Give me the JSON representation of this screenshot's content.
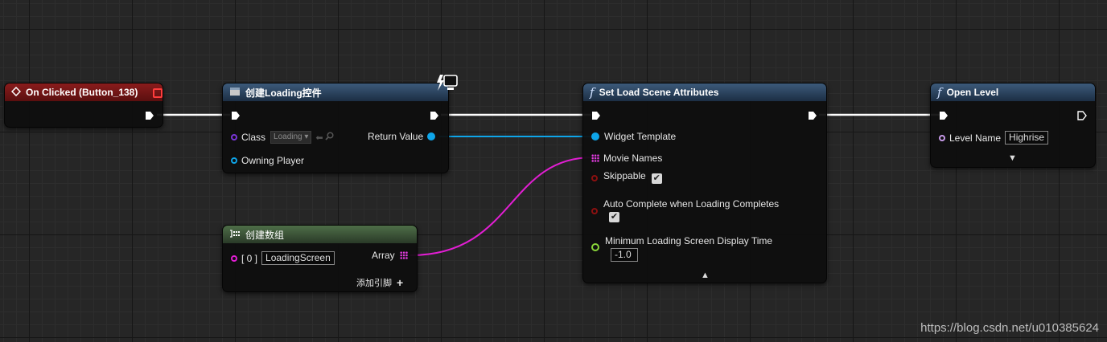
{
  "graph": {
    "event_node": {
      "title": "On Clicked (Button_138)"
    },
    "create_widget_node": {
      "title": "创建Loading控件",
      "class_label": "Class",
      "class_value": "Loading",
      "return_label": "Return Value",
      "owner_label": "Owning Player"
    },
    "make_array_node": {
      "title": "创建数组",
      "index_label": "[ 0 ]",
      "index_value": "LoadingScreen",
      "array_label": "Array",
      "add_pin_label": "添加引脚"
    },
    "set_load_scene_node": {
      "title": "Set Load Scene Attributes",
      "widget_template_label": "Widget Template",
      "movie_names_label": "Movie Names",
      "skippable_label": "Skippable",
      "auto_complete_label": "Auto Complete when Loading Completes",
      "min_time_label": "Minimum Loading Screen Display Time",
      "min_time_value": "-1.0"
    },
    "open_level_node": {
      "title": "Open Level",
      "level_name_label": "Level Name",
      "level_name_value": "Highrise"
    }
  },
  "watermark": "https://blog.csdn.net/u010385624",
  "colors": {
    "exec_wire": "#ffffff",
    "object_wire": "#0ea5e9",
    "array_wire": "#e21ed3",
    "event_header": "#8a1c1c",
    "function_header": "#3c5a7a",
    "make_array_header": "#4e6e48"
  }
}
